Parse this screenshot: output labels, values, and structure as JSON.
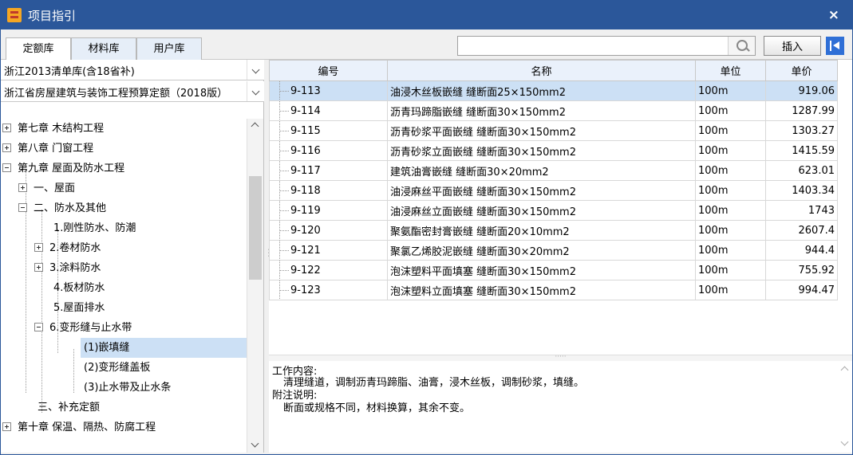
{
  "window": {
    "title": "项目指引",
    "close": "×"
  },
  "tabs": [
    {
      "label": "定额库",
      "active": true
    },
    {
      "label": "材料库",
      "active": false
    },
    {
      "label": "用户库",
      "active": false
    }
  ],
  "search": {
    "value": "",
    "placeholder": ""
  },
  "toolbar": {
    "insert_label": "插入"
  },
  "library_select": "浙江2013清单库(含18省补)",
  "quota_select": "浙江省房屋建筑与装饰工程预算定额（2018版）",
  "tree": [
    {
      "label": "第七章 木结构工程",
      "toggle": "plus",
      "level": 0
    },
    {
      "label": "第八章 门窗工程",
      "toggle": "plus",
      "level": 0
    },
    {
      "label": "第九章 屋面及防水工程",
      "toggle": "minus",
      "level": 0
    },
    {
      "label": "一、屋面",
      "toggle": "plus",
      "level": 1
    },
    {
      "label": "二、防水及其他",
      "toggle": "minus",
      "level": 1
    },
    {
      "label": "1.刚性防水、防潮",
      "toggle": "none",
      "level": 2
    },
    {
      "label": "2.卷材防水",
      "toggle": "plus",
      "level": 2
    },
    {
      "label": "3.涂料防水",
      "toggle": "plus",
      "level": 2
    },
    {
      "label": "4.板材防水",
      "toggle": "none",
      "level": 2
    },
    {
      "label": "5.屋面排水",
      "toggle": "none",
      "level": 2
    },
    {
      "label": "6.变形缝与止水带",
      "toggle": "minus",
      "level": 2
    },
    {
      "label": "(1)嵌填缝",
      "toggle": "none",
      "level": 3,
      "selected": true
    },
    {
      "label": "(2)变形缝盖板",
      "toggle": "none",
      "level": 3
    },
    {
      "label": "(3)止水带及止水条",
      "toggle": "none",
      "level": 3
    },
    {
      "label": "三、补充定额",
      "toggle": "none",
      "level": 1
    },
    {
      "label": "第十章 保温、隔热、防腐工程",
      "toggle": "plus",
      "level": 0
    }
  ],
  "table": {
    "headers": [
      "编号",
      "名称",
      "单位",
      "单价"
    ],
    "rows": [
      {
        "code": "9-113",
        "name": "油浸木丝板嵌缝 缝断面25×150mm2",
        "unit": "100m",
        "price": "919.06",
        "selected": true
      },
      {
        "code": "9-114",
        "name": "沥青玛蹄脂嵌缝 缝断面30×150mm2",
        "unit": "100m",
        "price": "1287.99"
      },
      {
        "code": "9-115",
        "name": "沥青砂浆平面嵌缝 缝断面30×150mm2",
        "unit": "100m",
        "price": "1303.27"
      },
      {
        "code": "9-116",
        "name": "沥青砂浆立面嵌缝 缝断面30×150mm2",
        "unit": "100m",
        "price": "1415.59"
      },
      {
        "code": "9-117",
        "name": "建筑油膏嵌缝 缝断面30×20mm2",
        "unit": "100m",
        "price": "623.01"
      },
      {
        "code": "9-118",
        "name": "油浸麻丝平面嵌缝 缝断面30×150mm2",
        "unit": "100m",
        "price": "1403.34"
      },
      {
        "code": "9-119",
        "name": "油浸麻丝立面嵌缝 缝断面30×150mm2",
        "unit": "100m",
        "price": "1743"
      },
      {
        "code": "9-120",
        "name": "聚氨酯密封膏嵌缝 缝断面20×10mm2",
        "unit": "100m",
        "price": "2607.4"
      },
      {
        "code": "9-121",
        "name": "聚氯乙烯胶泥嵌缝 缝断面30×20mm2",
        "unit": "100m",
        "price": "944.4"
      },
      {
        "code": "9-122",
        "name": "泡沫塑料平面填塞 缝断面30×150mm2",
        "unit": "100m",
        "price": "755.92"
      },
      {
        "code": "9-123",
        "name": "泡沫塑料立面填塞 缝断面30×150mm2",
        "unit": "100m",
        "price": "994.47"
      }
    ]
  },
  "description": {
    "work_label": "工作内容:",
    "work_text": "清理缝道，调制沥青玛蹄脂、油膏，浸木丝板，调制砂浆，填缝。",
    "note_label": "附注说明:",
    "note_text": "断面或规格不同，材料换算，其余不变。"
  },
  "colors": {
    "titlebar": "#2b579a",
    "selected": "#cce0f5",
    "header": "#eaf1fb"
  }
}
